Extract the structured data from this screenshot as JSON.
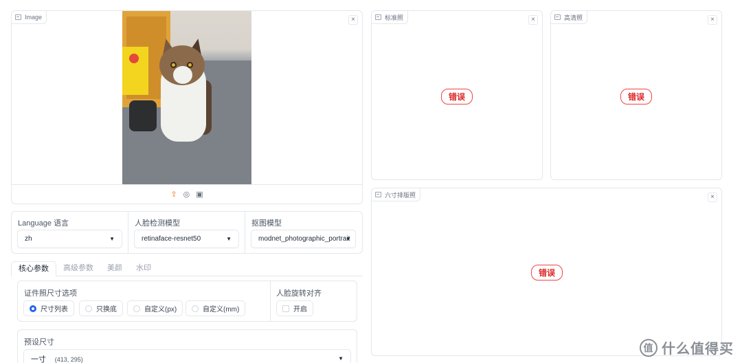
{
  "input_panel": {
    "label": "Image",
    "close": "×",
    "toolbar": {
      "upload_icon": "upload-icon",
      "webcam_icon": "webcam-icon",
      "clipboard_icon": "clipboard-icon"
    }
  },
  "output_panels": [
    {
      "label": "标准照",
      "close": "×",
      "status": "错误"
    },
    {
      "label": "高清照",
      "close": "×",
      "status": "错误"
    },
    {
      "label": "六寸排版照",
      "close": "×",
      "status": "错误"
    }
  ],
  "dropdowns": {
    "language": {
      "label": "Language 语言",
      "value": "zh"
    },
    "face_model": {
      "label": "人脸检测模型",
      "value": "retinaface-resnet50"
    },
    "matting_model": {
      "label": "抠图模型",
      "value": "modnet_photographic_portrait"
    }
  },
  "tabs": [
    "核心参数",
    "高级参数",
    "美颜",
    "水印"
  ],
  "size_options": {
    "label": "证件照尺寸选项",
    "options": [
      "尺寸列表",
      "只换底",
      "自定义(px)",
      "自定义(mm)"
    ],
    "selected_index": 0
  },
  "face_align": {
    "label": "人脸旋转对齐",
    "checkbox_label": "开启",
    "checked": false
  },
  "preset_size": {
    "label": "预设尺寸",
    "value_name": "一寸",
    "value_dims": "(413, 295)"
  },
  "watermark": {
    "text": "什么值得买",
    "logo": "值"
  },
  "colors": {
    "accent_blue": "#2563eb",
    "error_red": "#dc2626",
    "upload_orange": "#f97316"
  }
}
